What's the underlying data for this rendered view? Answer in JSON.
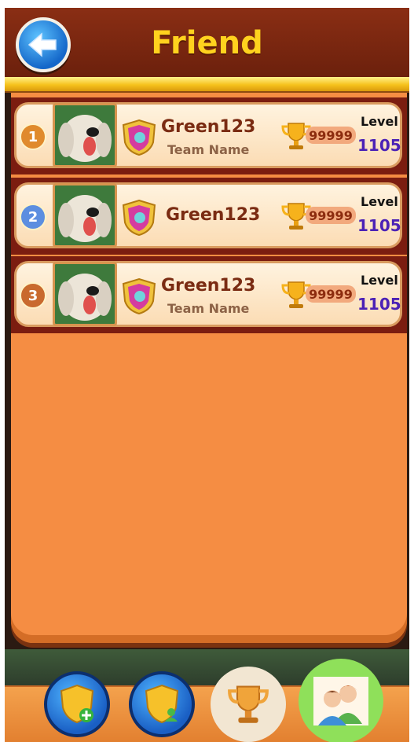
{
  "header": {
    "title": "Friend"
  },
  "colors": {
    "accent": "#ffd21e",
    "panel": "#f58d43",
    "header": "#7a2410",
    "level": "#4b22b6"
  },
  "rows": [
    {
      "rank": "1",
      "name": "Green123",
      "team": "Team Name",
      "score": "99999",
      "level_label": "Level",
      "level": "1105",
      "rank_color": "#e08a2c"
    },
    {
      "rank": "2",
      "name": "Green123",
      "team": "",
      "score": "99999",
      "level_label": "Level",
      "level": "1105",
      "rank_color": "#5c8ee0"
    },
    {
      "rank": "3",
      "name": "Green123",
      "team": "Team Name",
      "score": "99999",
      "level_label": "Level",
      "level": "1105",
      "rank_color": "#c96a2e"
    }
  ],
  "nav": {
    "items": [
      {
        "icon": "add-friend-shield-icon"
      },
      {
        "icon": "friend-shield-icon"
      },
      {
        "icon": "trophy-icon"
      },
      {
        "icon": "friends-icon",
        "active": true
      }
    ]
  }
}
